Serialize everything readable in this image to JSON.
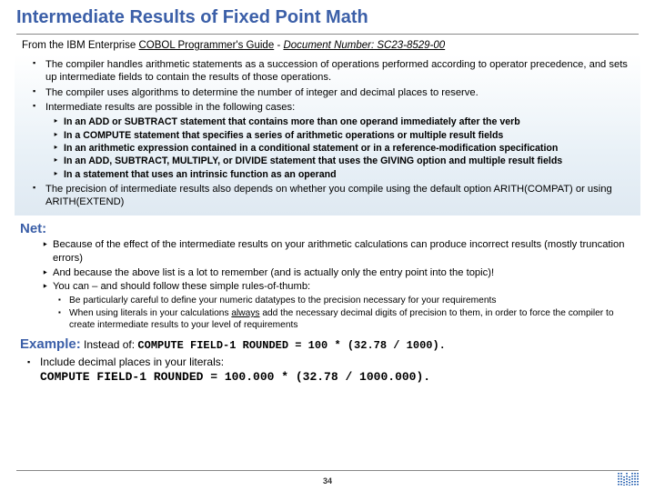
{
  "title": "Intermediate Results of Fixed Point Math",
  "source": {
    "prefix": "From the IBM Enterprise ",
    "guide": "COBOL Programmer's Guide",
    "sep": " - ",
    "docnum": "Document Number: SC23-8529-00"
  },
  "bullets": [
    "The compiler handles arithmetic statements as a succession of operations performed according to operator precedence, and sets up intermediate fields to contain the results of those operations.",
    "The compiler uses algorithms to determine the number of integer and decimal places to reserve.",
    "Intermediate results are possible in the following cases:",
    "The precision of intermediate results also depends on whether you compile using the default option ARITH(COMPAT) or using ARITH(EXTEND)"
  ],
  "cases": [
    "In an ADD or SUBTRACT statement that contains more than one operand immediately after the verb",
    "In a COMPUTE statement that specifies a series of arithmetic operations or multiple result fields",
    "In an arithmetic expression contained in a conditional statement or in a reference-modification specification",
    "In an ADD, SUBTRACT, MULTIPLY, or DIVIDE statement that uses the GIVING option and multiple result fields",
    "In a statement that uses an intrinsic function as an operand"
  ],
  "net": {
    "heading": "Net:",
    "items": [
      "Because of the effect of the intermediate results on your arithmetic calculations can produce incorrect results (mostly truncation errors)",
      "And because the above list is a lot to remember (and is actually only the entry point into the topic)!",
      "You can – and should follow these simple rules-of-thumb:"
    ],
    "sub": [
      "Be particularly careful to define your numeric datatypes to the precision necessary for your requirements"
    ],
    "sub1_a": "When using literals in your calculations ",
    "sub1_u": "always",
    "sub1_b": " add the necessary decimal digits of precision to them, in order to force the compiler to create intermediate results to your level of requirements"
  },
  "example": {
    "label": "Example:",
    "lead": " Instead of: ",
    "code1": "COMPUTE FIELD-1 ROUNDED = 100 * (32.78 / 1000).",
    "include": "Include decimal places in your literals:",
    "code2": "COMPUTE FIELD-1 ROUNDED = 100.000 * (32.78 / 1000.000)."
  },
  "page": "34"
}
